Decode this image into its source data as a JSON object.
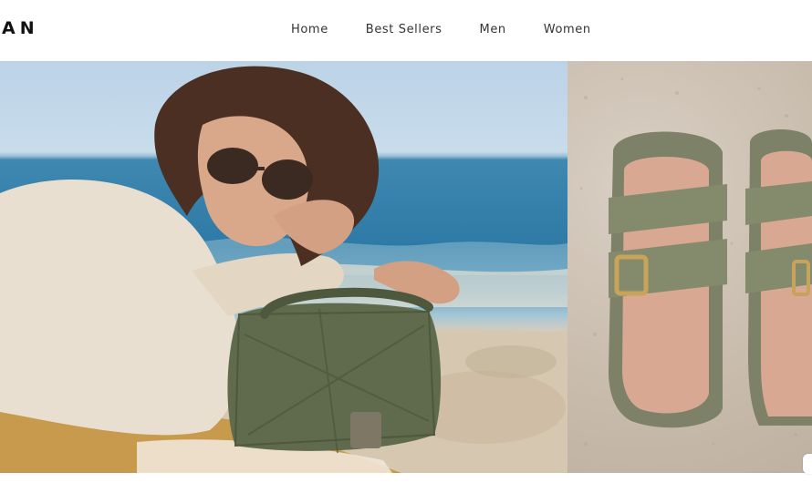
{
  "header": {
    "logo_text": "AN",
    "nav": [
      {
        "label": "Home"
      },
      {
        "label": "Best Sellers"
      },
      {
        "label": "Men"
      },
      {
        "label": "Women"
      }
    ]
  },
  "hero": {
    "left_image": "woman-on-beach-with-green-handbag-photo",
    "right_image": "green-sandals-on-sand-photo"
  },
  "colors": {
    "accent": "#6f7a5c",
    "text": "#333333"
  }
}
